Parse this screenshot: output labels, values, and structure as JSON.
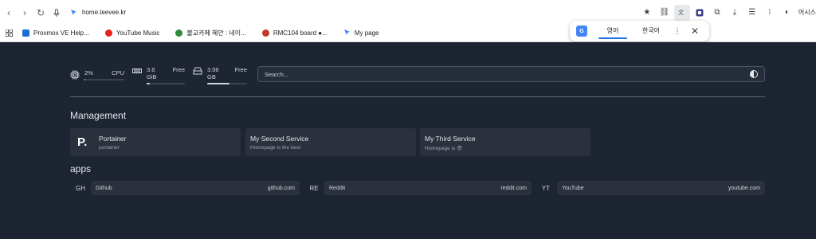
{
  "browser": {
    "url": "home.teevee.kr",
    "profile_label": "어시스",
    "bookmarks": [
      {
        "label": "Proxmox VE Help...",
        "color": "#1f6fd1"
      },
      {
        "label": "YouTube Music",
        "color": "#e62117"
      },
      {
        "label": "불교카페 혜안 : 네이...",
        "color": "#2e8b3a"
      },
      {
        "label": "RMC104 board ●...",
        "color": "#c0392b"
      },
      {
        "label": "My page",
        "color": "#3b82f6"
      }
    ]
  },
  "translate_popup": {
    "source_lang": "영어",
    "target_lang": "한국어"
  },
  "widgets": {
    "cpu": {
      "value": "2%",
      "label": "CPU",
      "percent": 2
    },
    "memory": {
      "value": "3.6 GiB",
      "label": "Free",
      "percent": 8
    },
    "disk": {
      "value": "3.06 GB",
      "label": "Free",
      "percent": 55
    }
  },
  "search": {
    "placeholder": "Search..."
  },
  "management": {
    "title": "Management",
    "services": [
      {
        "name": "Portainer",
        "description": "portainer",
        "logo": "P."
      },
      {
        "name": "My Second Service",
        "description": "Homepage is the best"
      },
      {
        "name": "My Third Service",
        "description": "Homepage is 😎"
      }
    ]
  },
  "apps": {
    "title": "apps",
    "items": [
      {
        "abbr": "GH",
        "name": "Github",
        "url": "github.com"
      },
      {
        "abbr": "RE",
        "name": "Reddit",
        "url": "reddit.com"
      },
      {
        "abbr": "YT",
        "name": "YouTube",
        "url": "youtube.com"
      }
    ]
  }
}
